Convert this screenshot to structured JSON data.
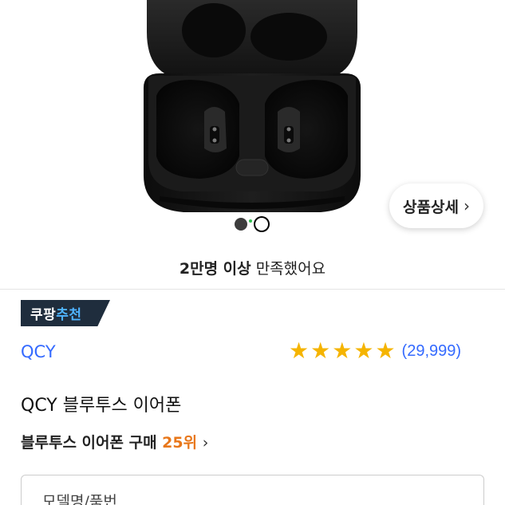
{
  "hero": {
    "detail_button_label": "상품상세",
    "carousel": {
      "total": 2,
      "active_index": 1
    }
  },
  "satisfaction": {
    "bold_text": "2만명 이상",
    "rest_text": " 만족했어요"
  },
  "badge": {
    "part1": "쿠팡",
    "part2": "추천"
  },
  "product": {
    "brand": "QCY",
    "rating": 5,
    "review_count": "(29,999)",
    "title": "QCY 블루투스 이어폰"
  },
  "ranking": {
    "category_text": "블루투스 이어폰 구매 ",
    "rank_text": "25위"
  },
  "option": {
    "label": "모델명/품번"
  },
  "colors": {
    "brand_link": "#346aff",
    "star": "#f5b400",
    "rank_accent": "#e8771a",
    "badge_bg": "#1f2d3d",
    "badge_accent": "#4fb3ff"
  },
  "icons": {
    "detail_chevron": "chevron-right-icon",
    "rank_chevron": "chevron-right-icon",
    "option_caret": "chevron-down-icon",
    "star": "star-icon"
  }
}
